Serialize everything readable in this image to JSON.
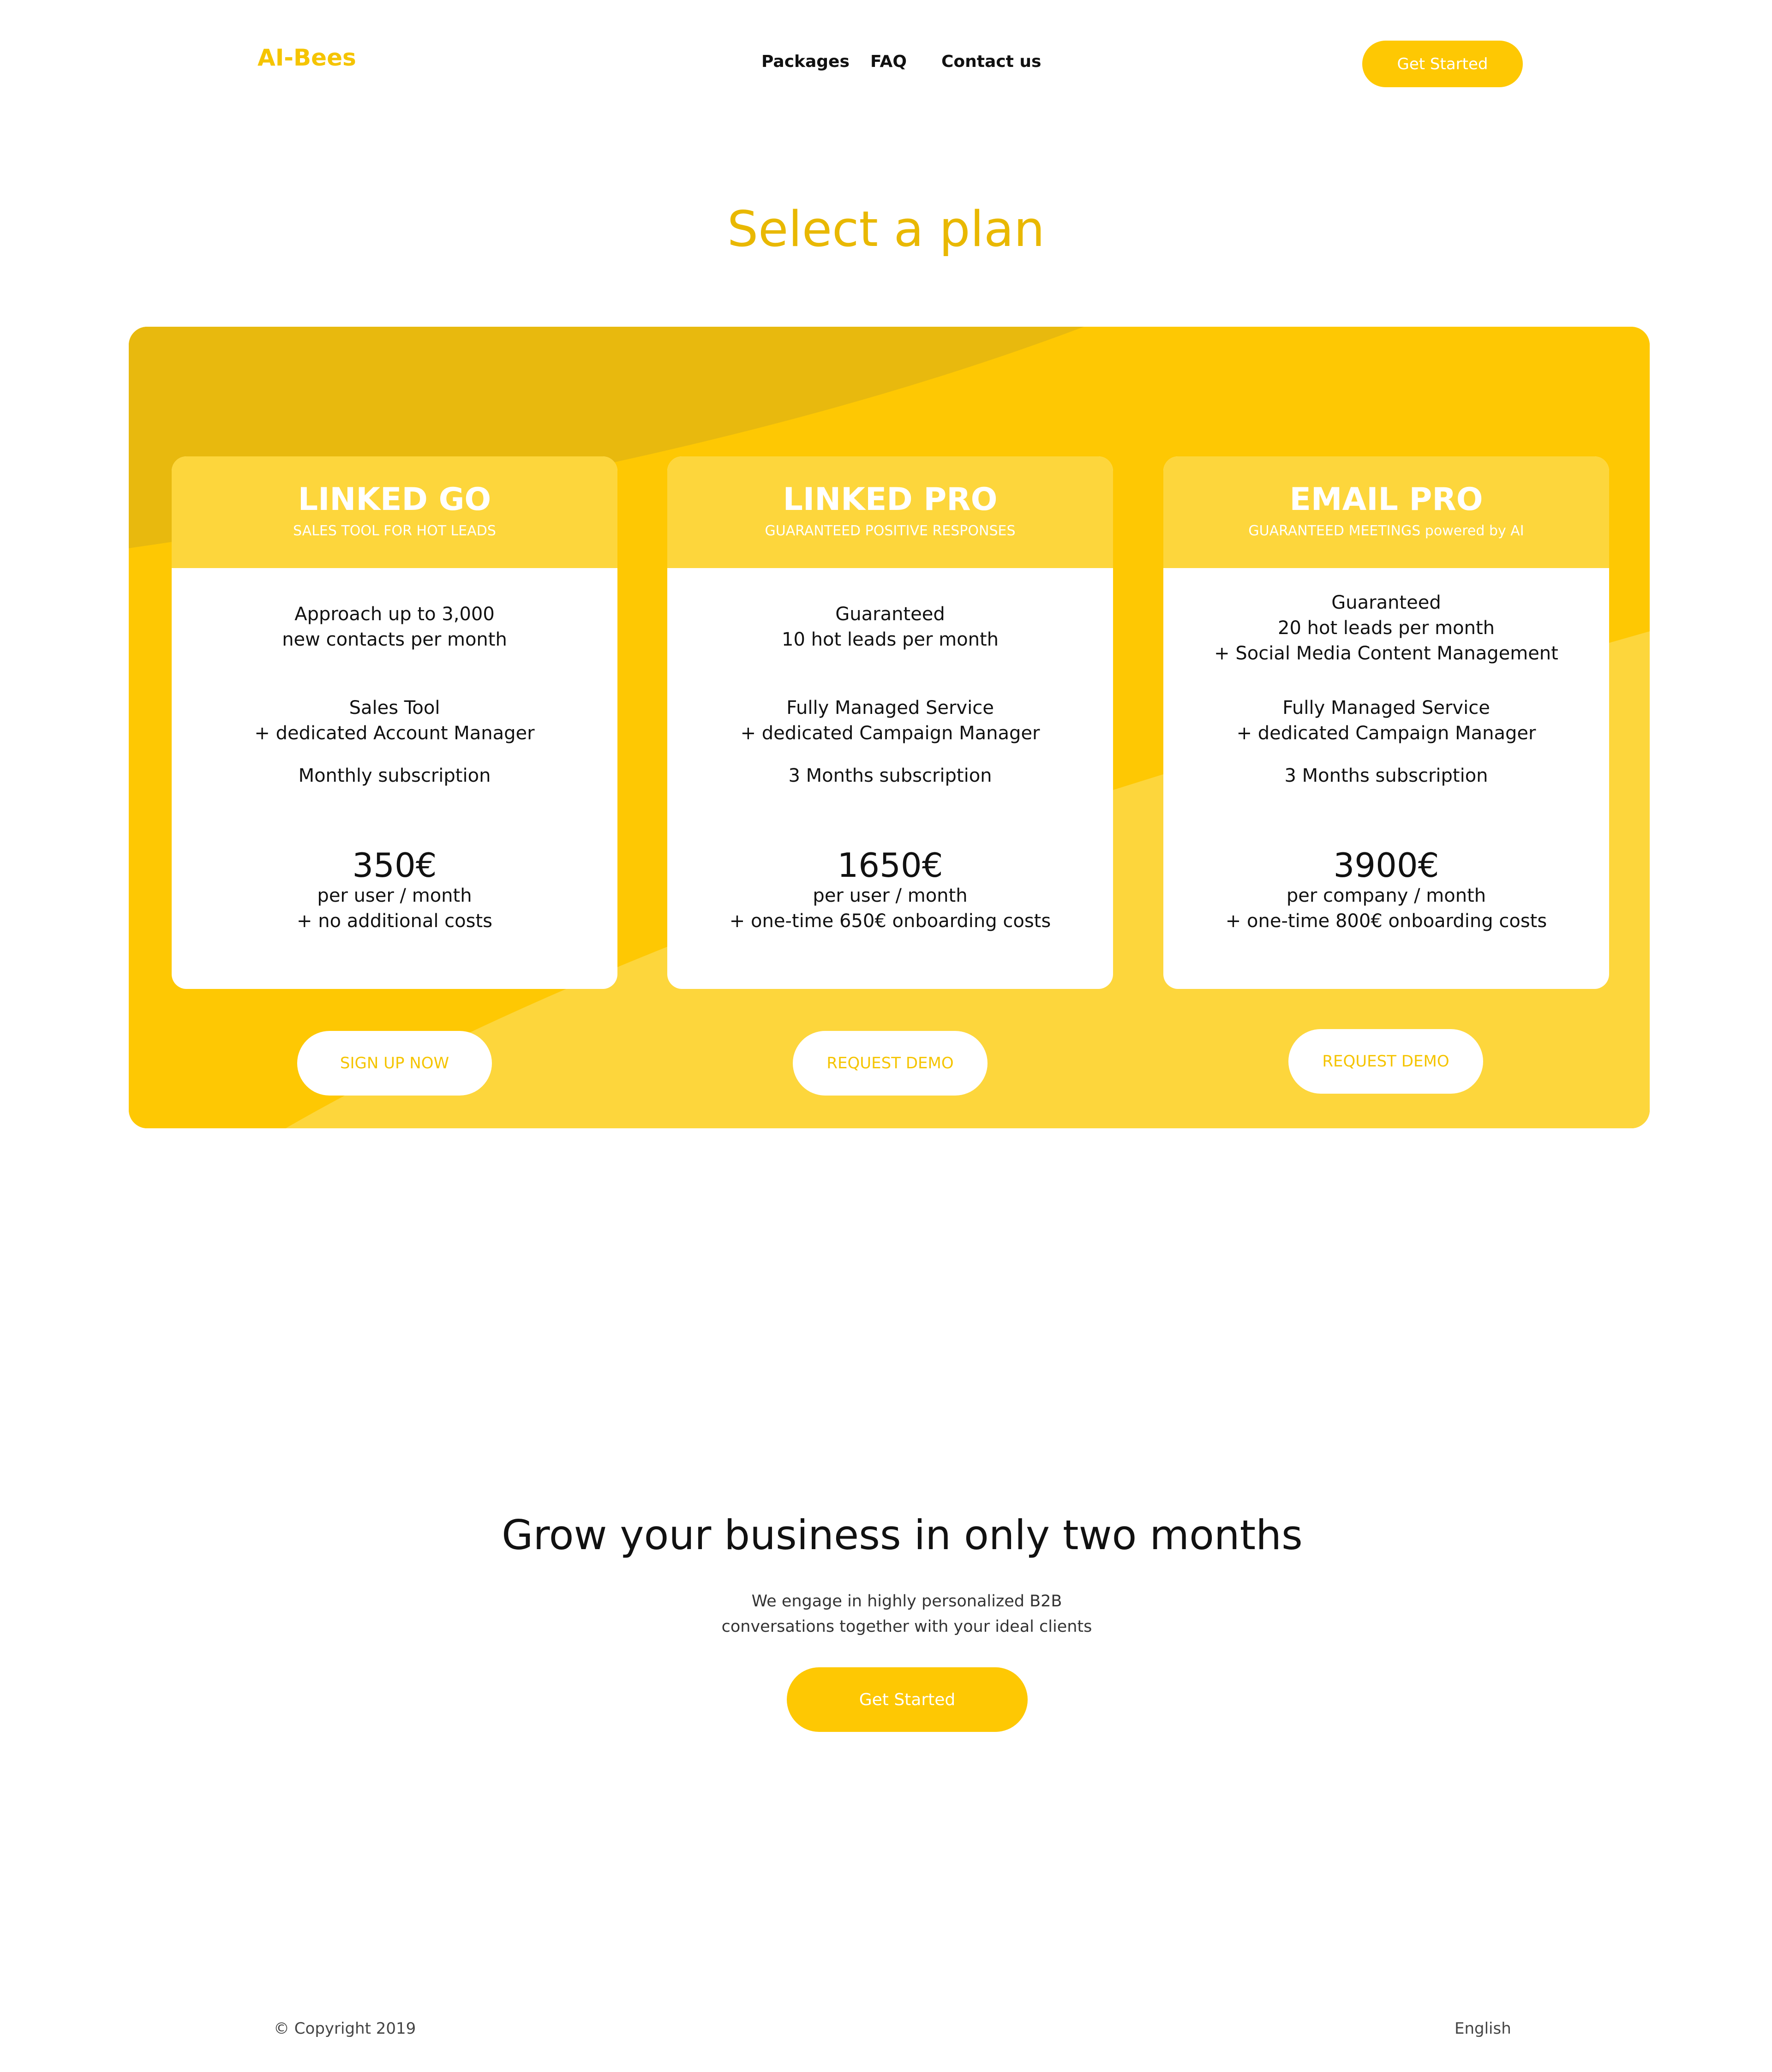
{
  "header": {
    "logo": "AI-Bees",
    "nav": [
      "Packages",
      "FAQ",
      "Contact us"
    ],
    "cta": "Get Started"
  },
  "plans_section": {
    "title": "Select a plan",
    "plans": [
      {
        "name": "LINKED GO",
        "tagline": "SALES TOOL FOR HOT LEADS",
        "features": [
          [
            "Approach up to 3,000",
            "new contacts per month"
          ],
          [
            "Sales Tool",
            "+ dedicated Account Manager"
          ],
          [
            "Monthly subscription"
          ]
        ],
        "price": "350€",
        "price_notes": [
          "per user / month",
          "+ no additional costs"
        ],
        "button": "SIGN UP NOW"
      },
      {
        "name": "LINKED PRO",
        "tagline": "GUARANTEED POSITIVE RESPONSES",
        "features": [
          [
            "Guaranteed",
            "10 hot leads per month"
          ],
          [
            "Fully Managed Service",
            "+ dedicated Campaign Manager"
          ],
          [
            "3 Months subscription"
          ]
        ],
        "price": "1650€",
        "price_notes": [
          "per user / month",
          "+ one-time 650€ onboarding costs"
        ],
        "button": "REQUEST DEMO"
      },
      {
        "name": "EMAIL PRO",
        "tagline": "GUARANTEED MEETINGS powered by AI",
        "features": [
          [
            "Guaranteed",
            "20 hot leads per month",
            "+ Social Media Content Management"
          ],
          [
            "Fully Managed Service",
            "+ dedicated Campaign Manager"
          ],
          [
            "3 Months subscription"
          ]
        ],
        "price": "3900€",
        "price_notes": [
          "per company / month",
          "+ one-time 800€ onboarding costs"
        ],
        "button": "REQUEST DEMO"
      }
    ]
  },
  "grow": {
    "title": "Grow your business in only two months",
    "description": [
      "We engage in highly personalized B2B",
      "conversations together with your ideal clients"
    ],
    "cta": "Get Started"
  },
  "footer": {
    "copyright": "© Copyright 2019",
    "language": "English"
  },
  "colors": {
    "brand_yellow": "#fec803",
    "dark_yellow": "#e8b90e",
    "light_yellow": "#fdd63c",
    "title_yellow": "#e9b800"
  }
}
